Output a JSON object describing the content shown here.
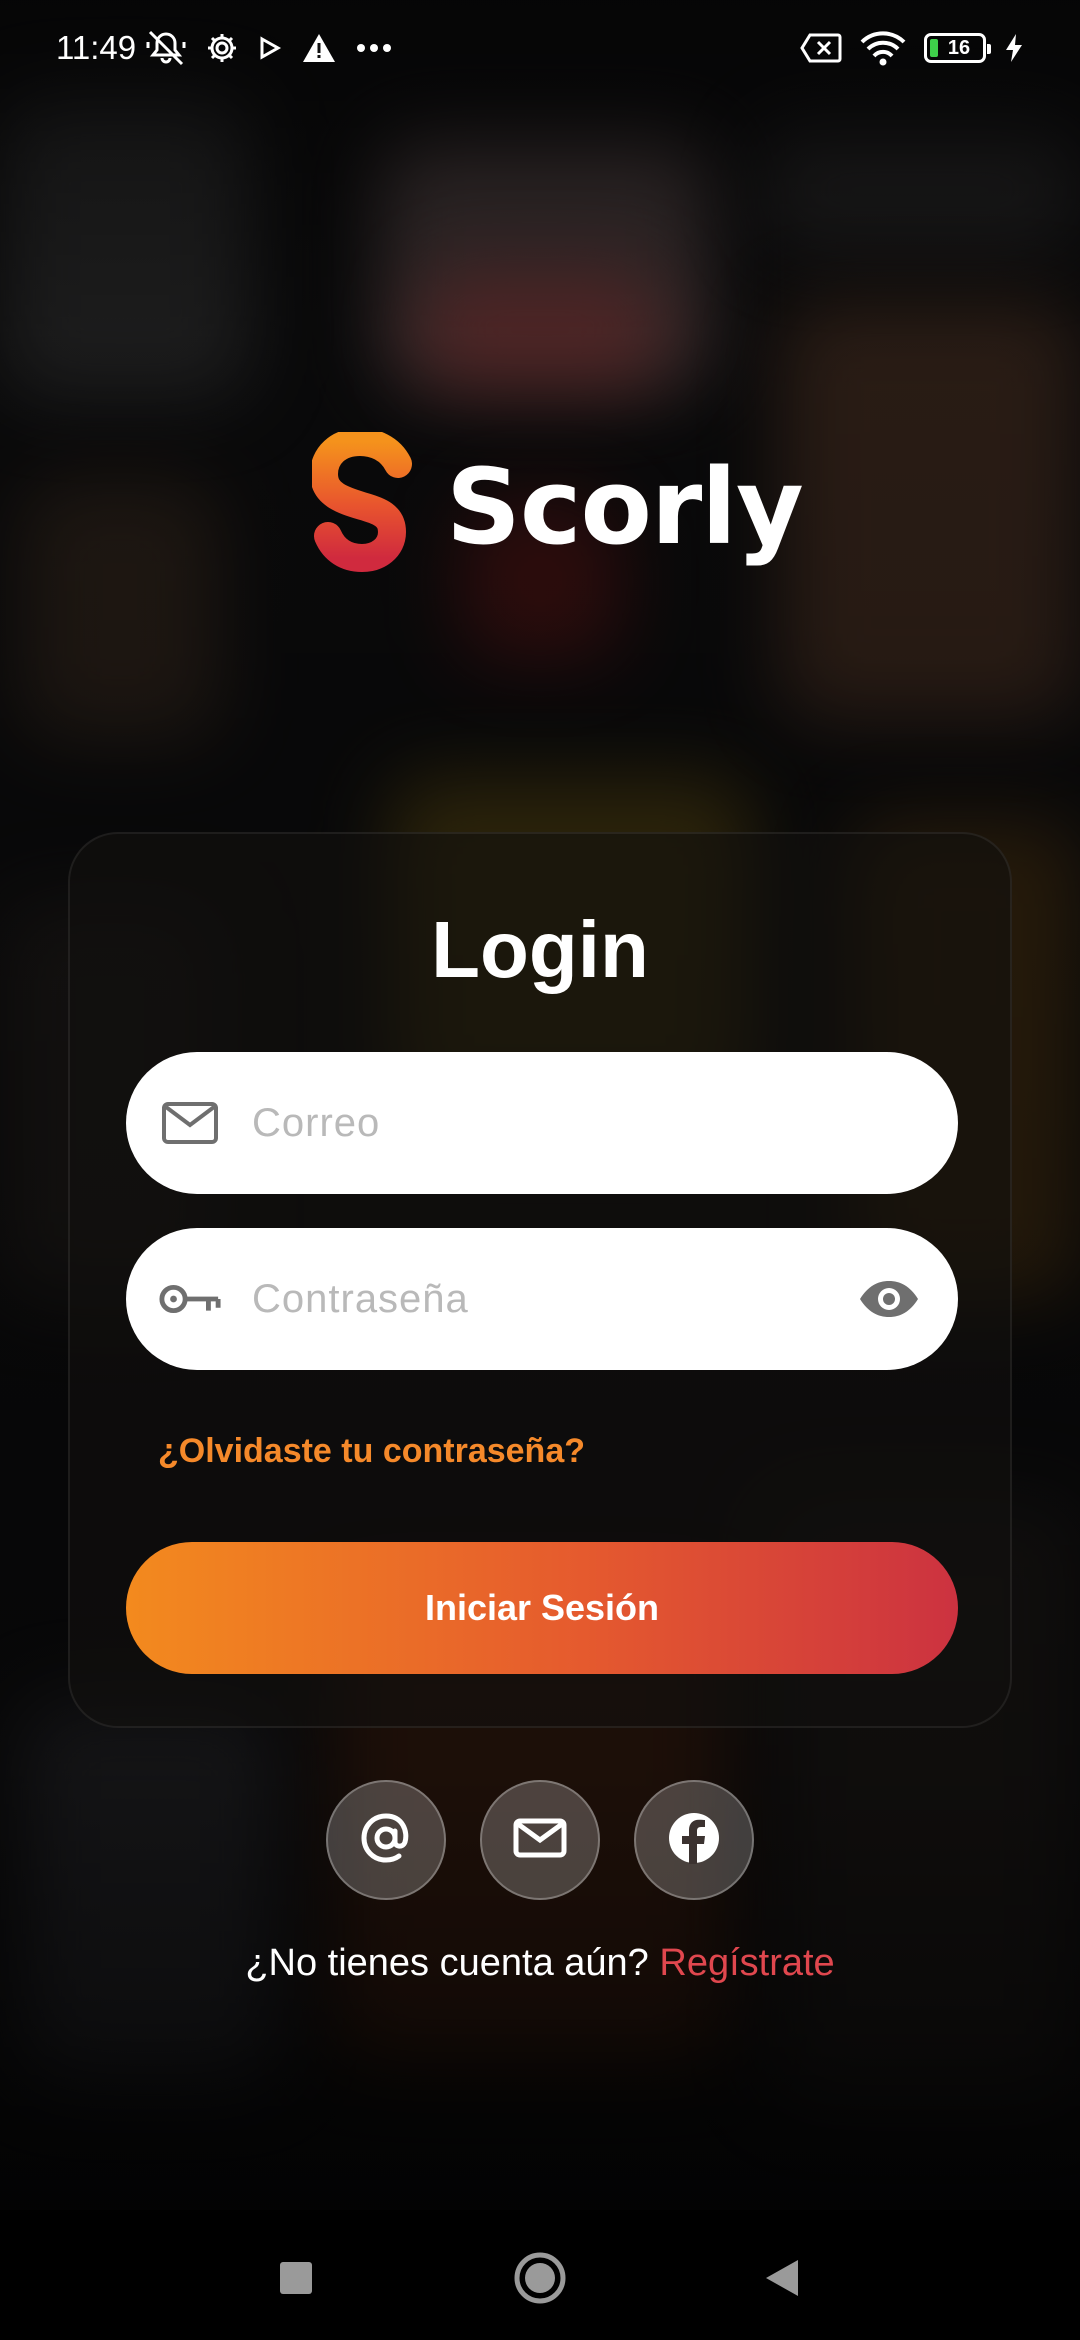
{
  "status_bar": {
    "time": "11:49",
    "battery_level": "16",
    "icons_left": [
      "mute-icon",
      "settings-icon",
      "play-icon",
      "warning-icon",
      "more-icon"
    ],
    "icons_right": [
      "no-sim-icon",
      "wifi-icon",
      "battery-icon",
      "charging-icon"
    ]
  },
  "app": {
    "name": "Scorly",
    "brand_colors": {
      "orange": "#F38A1E",
      "red": "#CC3240"
    }
  },
  "login": {
    "title": "Login",
    "email_placeholder": "Correo",
    "email_value": "",
    "password_placeholder": "Contraseña",
    "password_value": "",
    "forgot_password": "¿Olvidaste tu contraseña?",
    "submit_label": "Iniciar Sesión"
  },
  "social_login": {
    "buttons": [
      {
        "icon": "at-sign-icon",
        "name": "email-at-login"
      },
      {
        "icon": "envelope-icon",
        "name": "mail-login"
      },
      {
        "icon": "facebook-icon",
        "name": "facebook-login"
      }
    ]
  },
  "register": {
    "prompt": "¿No tienes cuenta aún?",
    "link": "Regístrate"
  },
  "nav_bar": {
    "buttons": [
      "recents-icon",
      "home-icon",
      "back-icon"
    ]
  }
}
